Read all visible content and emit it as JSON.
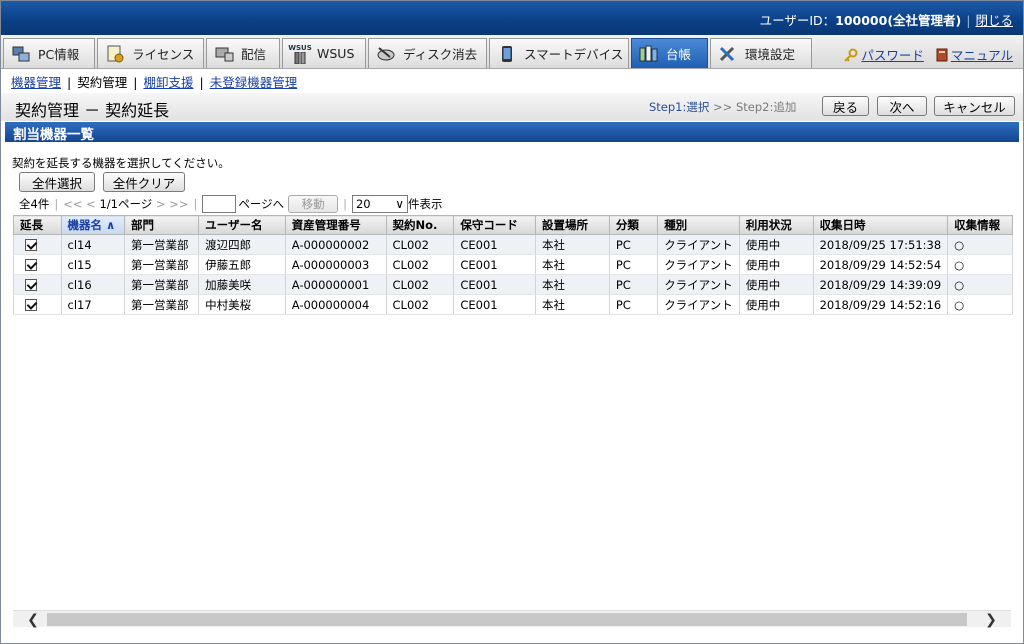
{
  "header": {
    "user_label": "ユーザーID：",
    "user_value": "100000(全社管理者)",
    "close_link": "閉じる"
  },
  "tabs": [
    {
      "label": "PC情報",
      "icon": "pc-icon"
    },
    {
      "label": "ライセンス",
      "icon": "license-icon"
    },
    {
      "label": "配信",
      "icon": "distribution-icon"
    },
    {
      "label": "WSUS",
      "icon": "wsus-icon",
      "badge": "WSUS"
    },
    {
      "label": "ディスク消去",
      "icon": "disk-erase-icon"
    },
    {
      "label": "スマートデバイス",
      "icon": "smart-device-icon"
    },
    {
      "label": "台帳",
      "icon": "ledger-icon",
      "active": true
    },
    {
      "label": "環境設定",
      "icon": "settings-tools-icon"
    }
  ],
  "toplinks": {
    "password": "パスワード",
    "manual": "マニュアル"
  },
  "subnav": {
    "items": [
      "機器管理",
      "契約管理",
      "棚卸支援",
      "未登録機器管理"
    ],
    "current": "契約管理"
  },
  "page": {
    "title": "契約管理 － 契約延長",
    "step1": "Step1:選択",
    "step_sep": ">>",
    "step2": "Step2:追加",
    "back": "戻る",
    "next": "次へ",
    "cancel": "キャンセル"
  },
  "section_title": "割当機器一覧",
  "instruction": "契約を延長する機器を選択してください。",
  "actions": {
    "select_all": "全件選択",
    "clear_all": "全件クリア"
  },
  "pager": {
    "total": "全4件",
    "first": "<<",
    "prev": "<",
    "pageinfo": "1/1ページ",
    "next": ">",
    "last": ">>",
    "goto_label": "ページへ",
    "move": "移動",
    "per_page": "20",
    "per_page_suffix": "件表示"
  },
  "table": {
    "columns": [
      "延長",
      "機器名",
      "部門",
      "ユーザー名",
      "資産管理番号",
      "契約No.",
      "保守コード",
      "設置場所",
      "分類",
      "種別",
      "利用状況",
      "収集日時",
      "収集情報"
    ],
    "sorted_column": "機器名",
    "rows": [
      {
        "checked": true,
        "device": "cl14",
        "dept": "第一営業部",
        "user": "渡辺四郎",
        "asset": "A-000000002",
        "contract": "CL002",
        "maint": "CE001",
        "location": "本社",
        "category": "PC",
        "type": "クライアント",
        "status": "使用中",
        "collected": "2018/09/25 17:51:38",
        "info": "○"
      },
      {
        "checked": true,
        "device": "cl15",
        "dept": "第一営業部",
        "user": "伊藤五郎",
        "asset": "A-000000003",
        "contract": "CL002",
        "maint": "CE001",
        "location": "本社",
        "category": "PC",
        "type": "クライアント",
        "status": "使用中",
        "collected": "2018/09/29 14:52:54",
        "info": "○"
      },
      {
        "checked": true,
        "device": "cl16",
        "dept": "第一営業部",
        "user": "加藤美咲",
        "asset": "A-000000001",
        "contract": "CL002",
        "maint": "CE001",
        "location": "本社",
        "category": "PC",
        "type": "クライアント",
        "status": "使用中",
        "collected": "2018/09/29 14:39:09",
        "info": "○"
      },
      {
        "checked": true,
        "device": "cl17",
        "dept": "第一営業部",
        "user": "中村美桜",
        "asset": "A-000000004",
        "contract": "CL002",
        "maint": "CE001",
        "location": "本社",
        "category": "PC",
        "type": "クライアント",
        "status": "使用中",
        "collected": "2018/09/29 14:52:16",
        "info": "○"
      }
    ]
  },
  "colors": {
    "header_blue": "#0b3f86",
    "active_tab": "#1f5fb3",
    "link": "#1a3fa8"
  }
}
